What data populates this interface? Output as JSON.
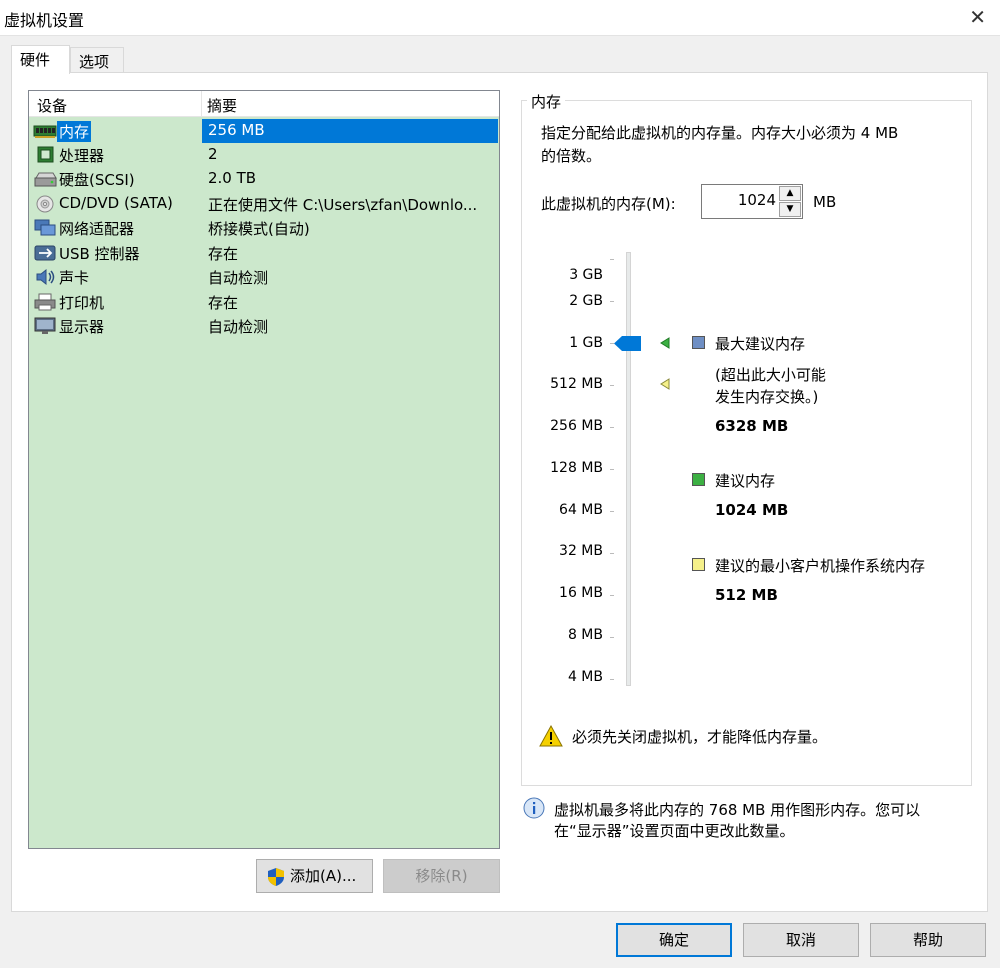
{
  "window": {
    "title": "虚拟机设置",
    "close": "✕"
  },
  "tabs": [
    {
      "label": "硬件"
    },
    {
      "label": "选项"
    }
  ],
  "devices": {
    "col_device": "设备",
    "col_summary": "摘要",
    "rows": [
      {
        "name": "内存",
        "summary": "256 MB",
        "icon": "memory-icon"
      },
      {
        "name": "处理器",
        "summary": "2",
        "icon": "processor-icon"
      },
      {
        "name": "硬盘(SCSI)",
        "summary": "2.0 TB",
        "icon": "hard-disk-icon"
      },
      {
        "name": "CD/DVD (SATA)",
        "summary": "正在使用文件 C:\\Users\\zfan\\Downlo...",
        "icon": "cd-dvd-icon"
      },
      {
        "name": "网络适配器",
        "summary": "桥接模式(自动)",
        "icon": "network-adapter-icon"
      },
      {
        "name": "USB 控制器",
        "summary": "存在",
        "icon": "usb-icon"
      },
      {
        "name": "声卡",
        "summary": "自动检测",
        "icon": "sound-card-icon"
      },
      {
        "name": "打印机",
        "summary": "存在",
        "icon": "printer-icon"
      },
      {
        "name": "显示器",
        "summary": "自动检测",
        "icon": "display-icon"
      }
    ],
    "add_button": "添加(A)...",
    "remove_button": "移除(R)"
  },
  "memory": {
    "group_title": "内存",
    "desc_line1": "指定分配给此虚拟机的内存量。内存大小必须为 4 MB",
    "desc_line2": "的倍数。",
    "field_label": "此虚拟机的内存(M):",
    "value": "1024",
    "unit": "MB",
    "scale": [
      "3 GB",
      "2 GB",
      "1 GB",
      "512 MB",
      "256 MB",
      "128 MB",
      "64 MB",
      "32 MB",
      "16 MB",
      "8 MB",
      "4 MB"
    ],
    "max_title": "最大建议内存",
    "max_note1": "(超出此大小可能",
    "max_note2": "发生内存交换。)",
    "max_value": "6328 MB",
    "rec_title": "建议内存",
    "rec_value": "1024 MB",
    "min_title": "建议的最小客户机操作系统内存",
    "min_value": "512 MB",
    "warning": "必须先关闭虚拟机，才能降低内存量。",
    "info_line1": "虚拟机最多将此内存的 768 MB 用作图形内存。您可以",
    "info_line2": "在“显示器”设置页面中更改此数量。",
    "colors": {
      "max": "#6f8fc4",
      "rec": "#3cb043",
      "min": "#f5f08a",
      "thumb": "#0078d7"
    }
  },
  "footer": {
    "ok": "确定",
    "cancel": "取消",
    "help": "帮助"
  }
}
